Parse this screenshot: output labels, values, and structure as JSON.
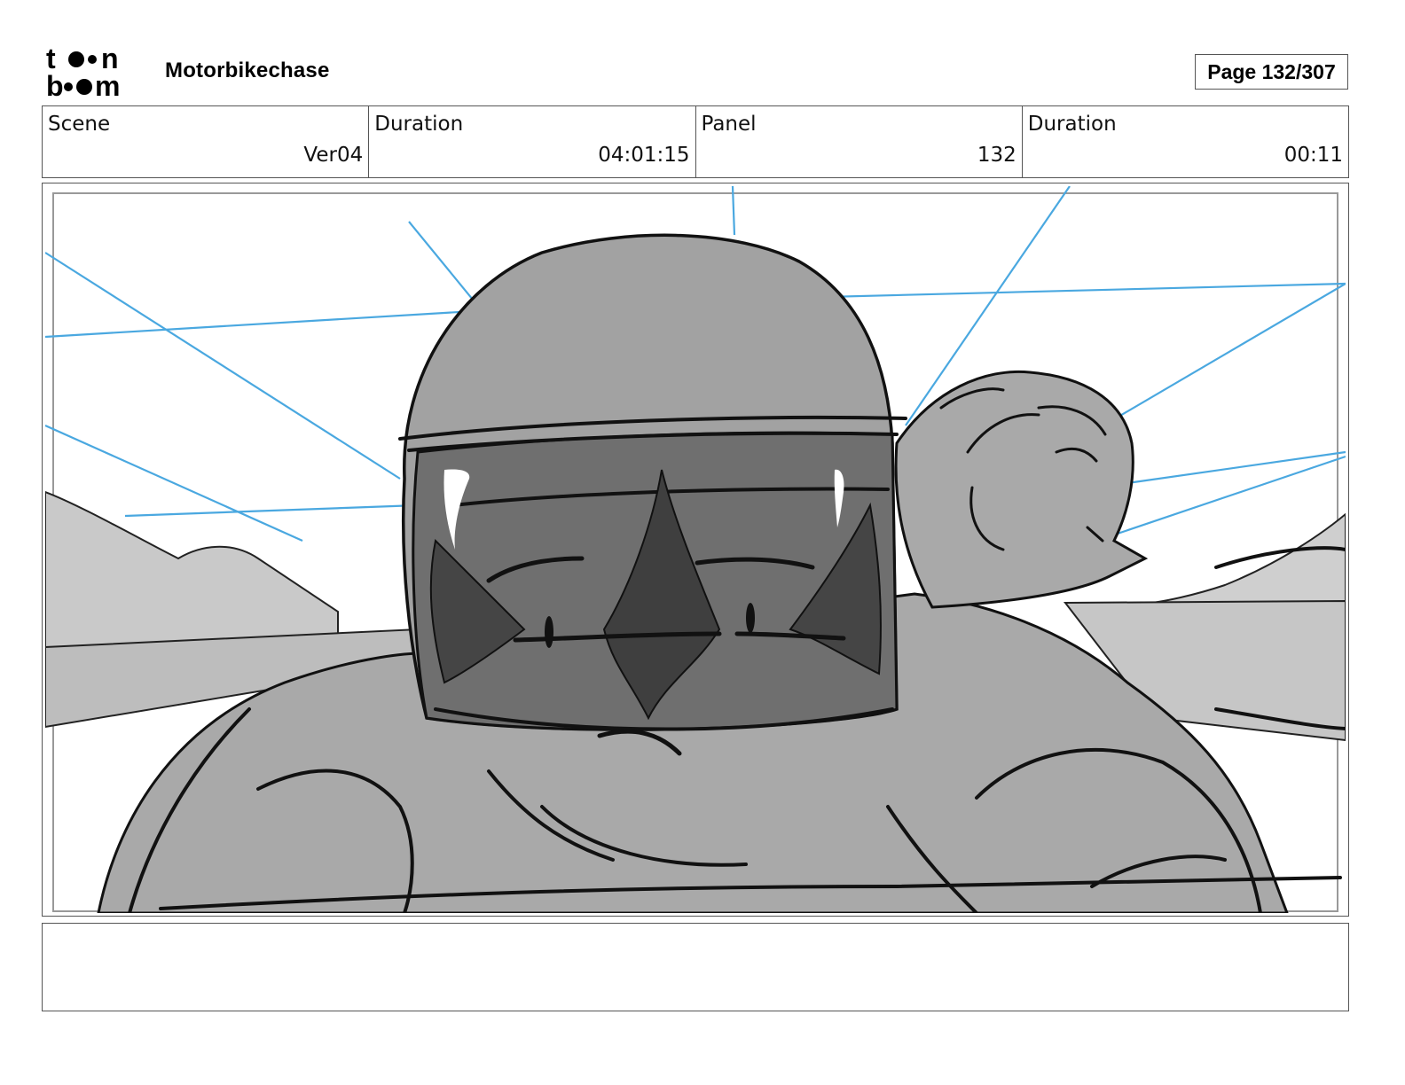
{
  "header": {
    "logo_text": "toon boom",
    "project_title": "Motorbikechase",
    "page_label": "Page 132/307"
  },
  "info": {
    "scene_label": "Scene",
    "scene_value": "Ver04",
    "duration_label": "Duration",
    "duration_value": "04:01:15",
    "panel_label": "Panel",
    "panel_value": "132",
    "panel_duration_label": "Duration",
    "panel_duration_value": "00:11"
  },
  "notes": {
    "text": ""
  },
  "colors": {
    "guide_lines": "#4aa8e0",
    "sketch_ink": "#111111",
    "tone_light": "#c4c4c4",
    "tone_mid": "#a7a7a7",
    "tone_dark": "#6e6e6e"
  }
}
